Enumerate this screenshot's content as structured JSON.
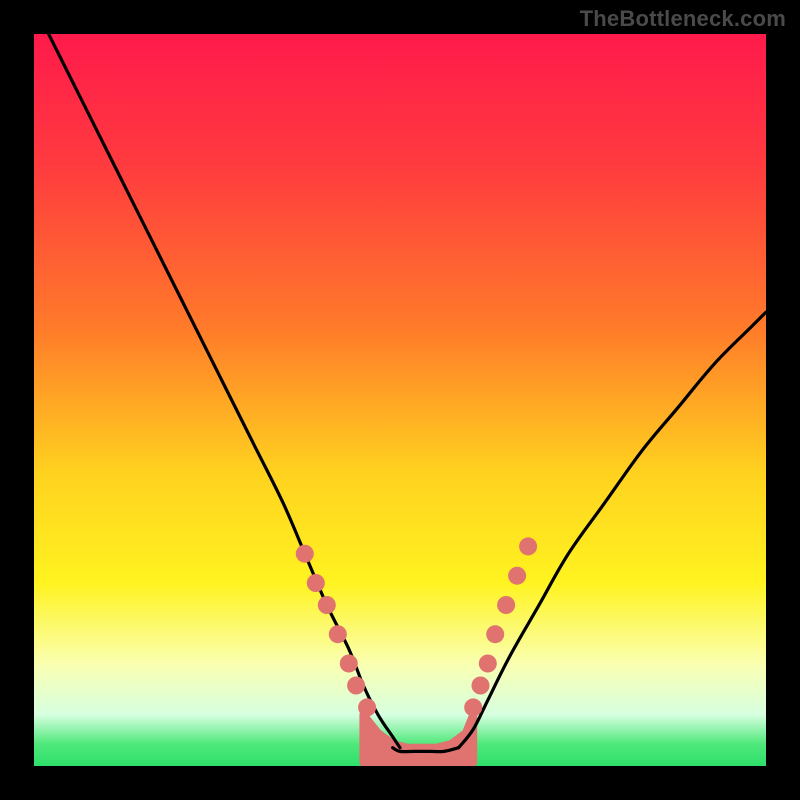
{
  "attribution": "TheBottleneck.com",
  "chart_data": {
    "type": "line",
    "title": "",
    "xlabel": "",
    "ylabel": "",
    "xlim": [
      0,
      100
    ],
    "ylim": [
      0,
      100
    ],
    "gradient_stops": [
      {
        "offset": 0.0,
        "color": "#ff1a4b"
      },
      {
        "offset": 0.18,
        "color": "#ff3b3f"
      },
      {
        "offset": 0.4,
        "color": "#ff7a2a"
      },
      {
        "offset": 0.6,
        "color": "#ffd21f"
      },
      {
        "offset": 0.75,
        "color": "#fff320"
      },
      {
        "offset": 0.86,
        "color": "#faffb0"
      },
      {
        "offset": 0.93,
        "color": "#d6ffe0"
      },
      {
        "offset": 0.97,
        "color": "#4fe87a"
      },
      {
        "offset": 1.0,
        "color": "#2ee06a"
      }
    ],
    "series": [
      {
        "name": "left-curve",
        "x": [
          2,
          6,
          10,
          14,
          18,
          22,
          26,
          30,
          34,
          37,
          40,
          43,
          45,
          47,
          49,
          50
        ],
        "y": [
          100,
          92,
          84,
          76,
          68,
          60,
          52,
          44,
          36,
          29,
          22,
          16,
          11,
          7,
          4,
          2.5
        ]
      },
      {
        "name": "right-curve",
        "x": [
          58,
          60,
          62,
          65,
          69,
          73,
          78,
          83,
          88,
          93,
          98,
          100
        ],
        "y": [
          2.5,
          5,
          9,
          15,
          22,
          29,
          36,
          43,
          49,
          55,
          60,
          62
        ]
      },
      {
        "name": "valley-floor",
        "x": [
          49,
          50,
          52,
          54,
          56,
          58
        ],
        "y": [
          2.5,
          2,
          2,
          2,
          2,
          2.5
        ]
      }
    ],
    "marker_clusters": [
      {
        "name": "left-cluster",
        "points": [
          {
            "x": 37.0,
            "y": 29
          },
          {
            "x": 38.5,
            "y": 25
          },
          {
            "x": 40.0,
            "y": 22
          },
          {
            "x": 41.5,
            "y": 18
          },
          {
            "x": 43.0,
            "y": 14
          },
          {
            "x": 44.0,
            "y": 11
          },
          {
            "x": 45.5,
            "y": 8
          }
        ]
      },
      {
        "name": "right-cluster",
        "points": [
          {
            "x": 60.0,
            "y": 8
          },
          {
            "x": 61.0,
            "y": 11
          },
          {
            "x": 62.0,
            "y": 14
          },
          {
            "x": 63.0,
            "y": 18
          },
          {
            "x": 64.5,
            "y": 22
          },
          {
            "x": 66.0,
            "y": 26
          },
          {
            "x": 67.5,
            "y": 30
          }
        ]
      }
    ],
    "valley_fill": {
      "color": "#e0736f",
      "x": [
        45,
        47,
        49,
        51,
        53,
        55,
        57,
        59,
        60
      ],
      "y_top": [
        7,
        4.5,
        3,
        2.5,
        2.5,
        2.5,
        3,
        4.5,
        7
      ],
      "y_bottom": 0.5
    },
    "marker_style": {
      "r": 9,
      "fill": "#e0736f"
    }
  }
}
